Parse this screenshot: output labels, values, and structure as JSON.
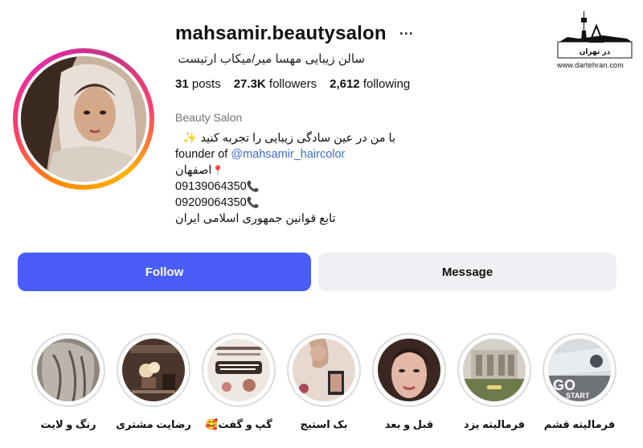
{
  "profile": {
    "username": "mahsamir.beautysalon",
    "full_name": "سالن زیبایی مهسا میر/میکاب ارتیست",
    "stats": {
      "posts_count": "31",
      "posts_label": "posts",
      "followers_count": "27.3K",
      "followers_label": "followers",
      "following_count": "2,612",
      "following_label": "following"
    },
    "category": "Beauty Salon",
    "bio": {
      "line1": "با من در عین سادگی زیبایی را تجربه کنید",
      "line2_prefix": "founder of",
      "line2_mention": "@mahsamir_haircolor",
      "line3": "اصفهان",
      "line4": "09139064350",
      "line5": "09209064350",
      "line6": "تابع قوانین جمهوری اسلامی ایران"
    }
  },
  "buttons": {
    "follow": "Follow",
    "message": "Message"
  },
  "highlights": [
    {
      "label": "رنگ و لایت"
    },
    {
      "label": "رضایت مشتری"
    },
    {
      "label": "گپ و گفت🥰"
    },
    {
      "label": "بک استیج"
    },
    {
      "label": "قبل و بعد"
    },
    {
      "label": "فرمالیته یزد"
    },
    {
      "label": "فرمالیته قشم"
    }
  ],
  "watermark": {
    "url": "www.dartehran.com",
    "logo_text": "در تهران"
  },
  "icons": {
    "more": "more-horizontal-icon",
    "sparkles": "sparkles-icon",
    "pin": "location-pin-icon",
    "phone": "phone-icon"
  },
  "colors": {
    "follow_button": "#4a5df9",
    "message_button": "#eff0f3",
    "mention_link": "#3b6cc7",
    "story_ring_gradient": [
      "#ff8a00",
      "#e62aa8",
      "#c13584"
    ]
  }
}
